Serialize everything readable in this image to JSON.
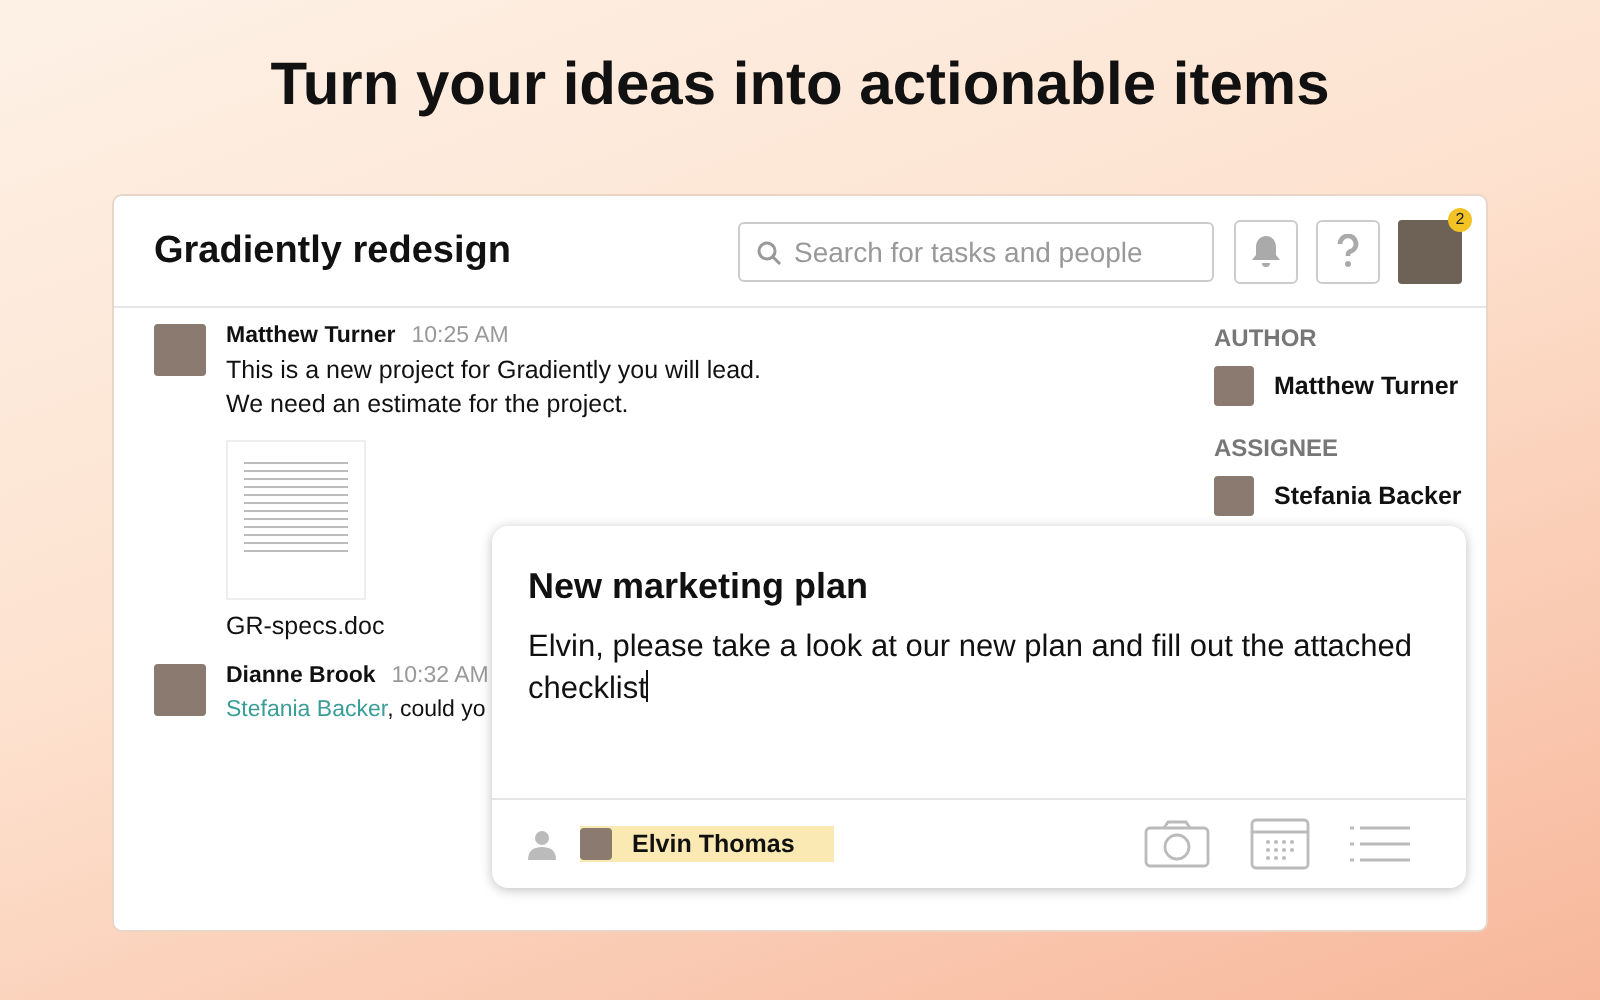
{
  "headline": "Turn your ideas into actionable items",
  "project": {
    "title": "Gradiently redesign"
  },
  "search": {
    "placeholder": "Search for tasks and people"
  },
  "profile": {
    "badge": "2"
  },
  "messages": [
    {
      "author": "Matthew Turner",
      "time": "10:25 AM",
      "lines": [
        "This is a new project for Gradiently you will lead.",
        "We need an estimate for the project."
      ],
      "attachment": {
        "name": "GR-specs.doc"
      }
    },
    {
      "author": "Dianne Brook",
      "time": "10:32 AM",
      "mention": "Stefania Backer",
      "text": ", could yo"
    }
  ],
  "sidebar": [
    {
      "heading": "AUTHOR",
      "person": "Matthew Turner"
    },
    {
      "heading": "ASSIGNEE",
      "person": "Stefania Backer"
    }
  ],
  "new_task": {
    "title": "New marketing plan",
    "body": "Elvin, please take a look at our new plan and fill out the attached checklist",
    "assignee": "Elvin Thomas"
  }
}
